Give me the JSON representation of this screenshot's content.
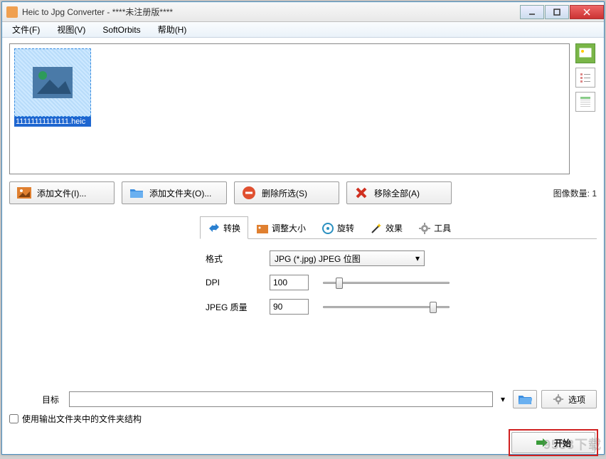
{
  "window": {
    "title": "Heic to Jpg Converter - ****未注册版****"
  },
  "menu": {
    "file": "文件(F)",
    "view": "视图(V)",
    "softorbits": "SoftOrbits",
    "help": "帮助(H)"
  },
  "thumb": {
    "filename": "11111111111111.heic"
  },
  "actions": {
    "add_file": "添加文件(I)...",
    "add_folder": "添加文件夹(O)...",
    "remove_sel": "删除所选(S)",
    "remove_all": "移除全部(A)"
  },
  "count": {
    "label": "图像数量: ",
    "value": "1"
  },
  "tabs": {
    "convert": "转换",
    "resize": "调整大小",
    "rotate": "旋转",
    "effects": "效果",
    "tools": "工具"
  },
  "form": {
    "format_label": "格式",
    "format_value": "JPG (*.jpg) JPEG 位图",
    "dpi_label": "DPI",
    "dpi_value": "100",
    "quality_label": "JPEG 质量",
    "quality_value": "90"
  },
  "bottom": {
    "dest_label": "目标",
    "dest_value": "",
    "options": "选项",
    "checkbox": "使用输出文件夹中的文件夹结构",
    "start": "开始"
  },
  "watermark": "9553下载"
}
